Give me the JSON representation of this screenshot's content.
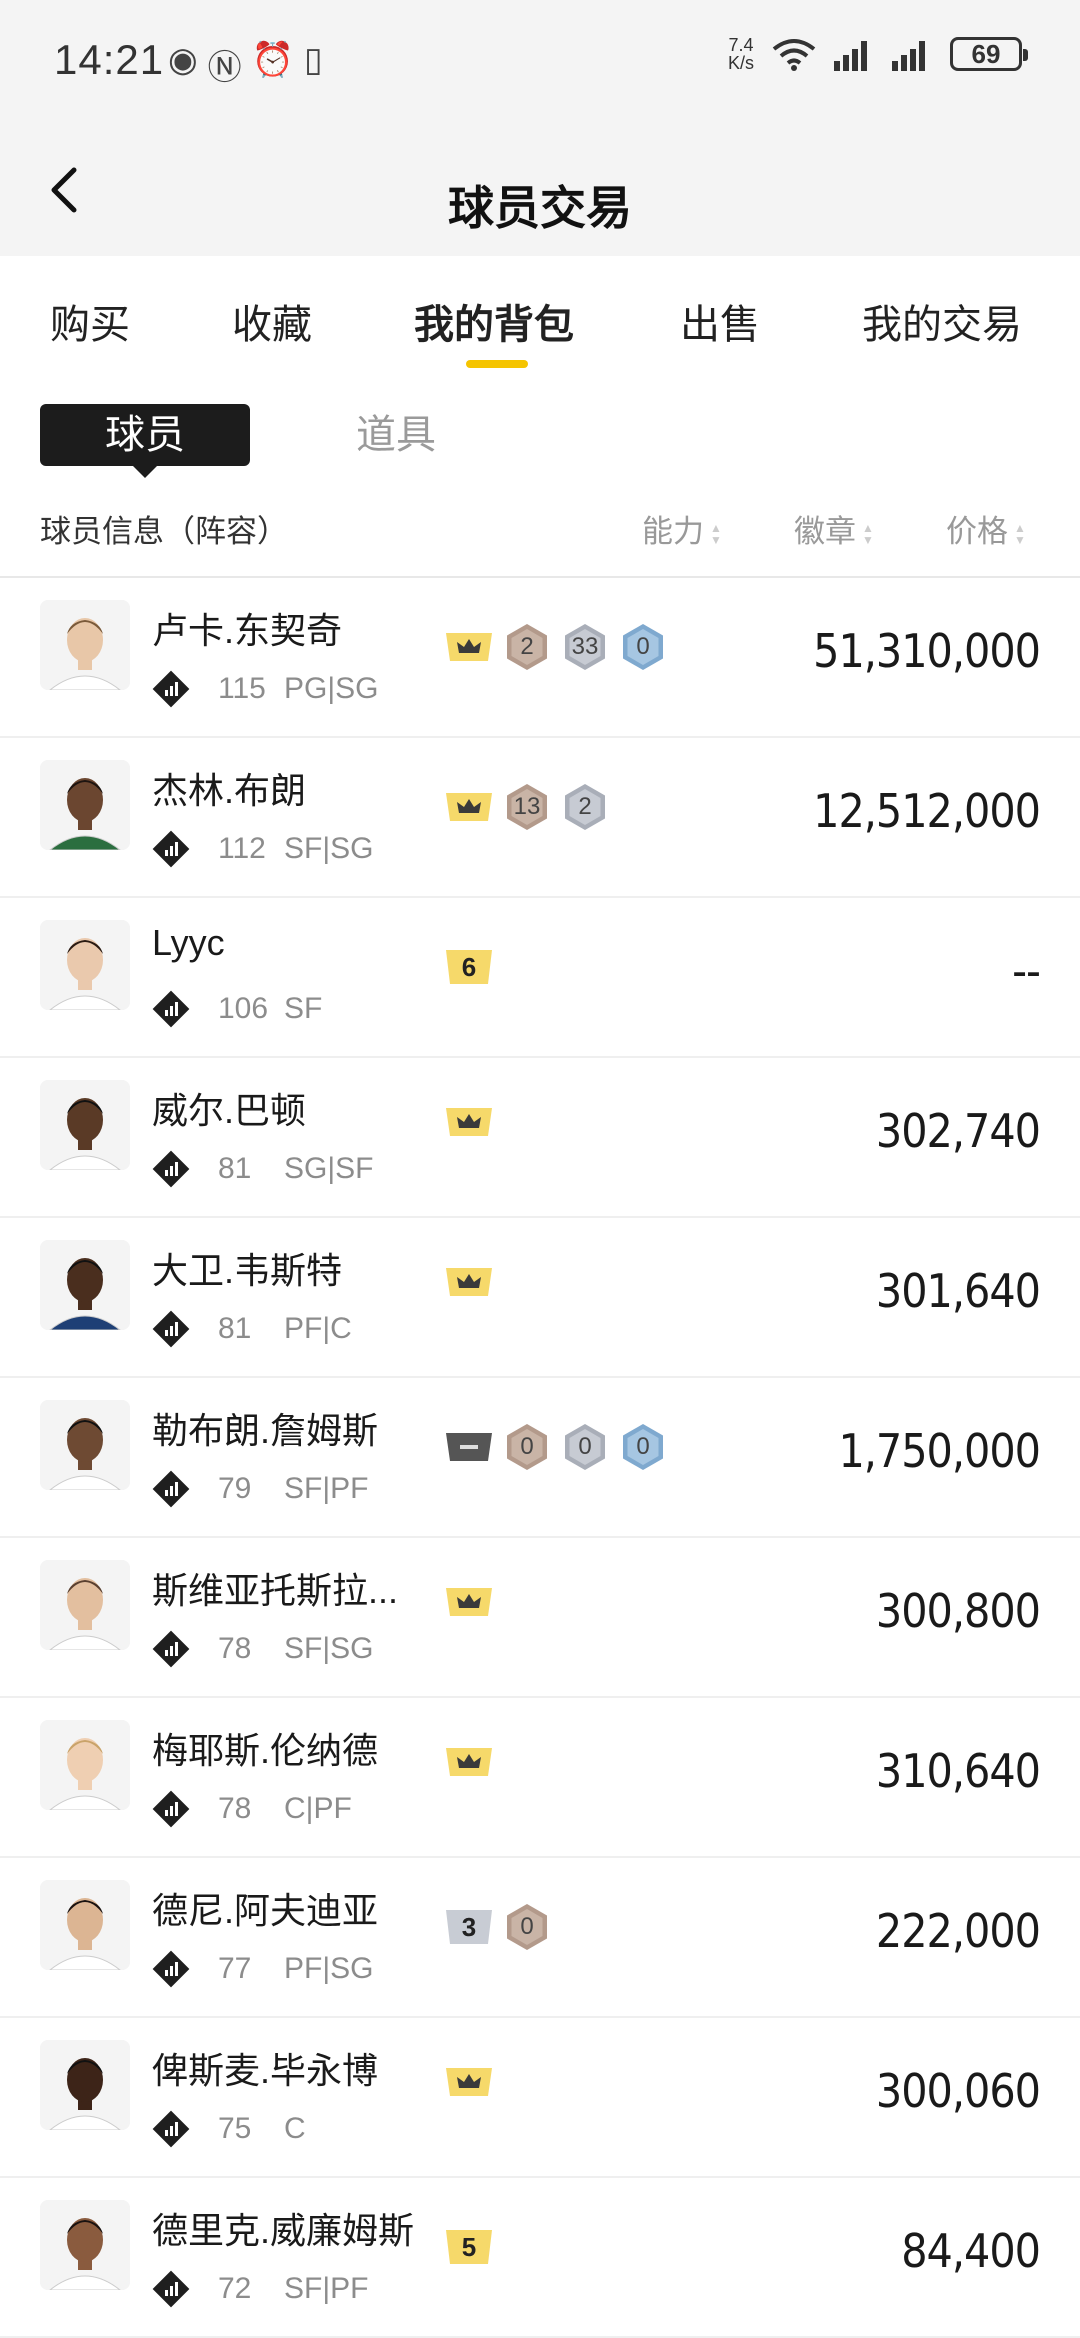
{
  "status_bar": {
    "time": "14:21",
    "net_speed_value": "7.4",
    "net_speed_unit": "K/s",
    "battery": "69"
  },
  "header": {
    "title": "球员交易"
  },
  "tabs": [
    {
      "label": "购买",
      "active": false
    },
    {
      "label": "收藏",
      "active": false
    },
    {
      "label": "我的背包",
      "active": true
    },
    {
      "label": "出售",
      "active": false
    },
    {
      "label": "我的交易",
      "active": false
    }
  ],
  "segments": {
    "players": "球员",
    "items": "道具"
  },
  "columns": {
    "info": "球员信息（阵容）",
    "ability": "能力",
    "badge": "徽章",
    "price": "价格"
  },
  "colors": {
    "accent": "#f5c400",
    "crown_bg": "#f6d96a",
    "badge_bronze": "#b39a8b",
    "badge_silver": "#a9aeb8",
    "badge_gold_blue": "#7fa9cf"
  },
  "players": [
    {
      "name": "卢卡.东契奇",
      "rating": "115",
      "positions": "PG|SG",
      "price": "51,310,000",
      "badges": [
        {
          "type": "crown"
        },
        {
          "type": "bronze",
          "value": "2"
        },
        {
          "type": "silver",
          "value": "33"
        },
        {
          "type": "blue",
          "value": "0"
        }
      ]
    },
    {
      "name": "杰林.布朗",
      "rating": "112",
      "positions": "SF|SG",
      "price": "12,512,000",
      "badges": [
        {
          "type": "crown"
        },
        {
          "type": "bronze",
          "value": "13"
        },
        {
          "type": "silver",
          "value": "2"
        }
      ]
    },
    {
      "name": "Lyyc",
      "rating": "106",
      "positions": "SF",
      "price": "--",
      "badges": [
        {
          "type": "yellow-num",
          "value": "6"
        }
      ]
    },
    {
      "name": "威尔.巴顿",
      "rating": "81",
      "positions": "SG|SF",
      "price": "302,740",
      "badges": [
        {
          "type": "crown"
        }
      ]
    },
    {
      "name": "大卫.韦斯特",
      "rating": "81",
      "positions": "PF|C",
      "price": "301,640",
      "badges": [
        {
          "type": "crown"
        }
      ]
    },
    {
      "name": "勒布朗.詹姆斯",
      "rating": "79",
      "positions": "SF|PF",
      "price": "1,750,000",
      "badges": [
        {
          "type": "dark-bar"
        },
        {
          "type": "bronze",
          "value": "0"
        },
        {
          "type": "silver",
          "value": "0"
        },
        {
          "type": "blue",
          "value": "0"
        }
      ]
    },
    {
      "name": "斯维亚托斯拉...",
      "rating": "78",
      "positions": "SF|SG",
      "price": "300,800",
      "badges": [
        {
          "type": "crown"
        }
      ]
    },
    {
      "name": "梅耶斯.伦纳德",
      "rating": "78",
      "positions": "C|PF",
      "price": "310,640",
      "badges": [
        {
          "type": "crown"
        }
      ]
    },
    {
      "name": "德尼.阿夫迪亚",
      "rating": "77",
      "positions": "PF|SG",
      "price": "222,000",
      "badges": [
        {
          "type": "silver-num",
          "value": "3"
        },
        {
          "type": "bronze",
          "value": "0"
        }
      ]
    },
    {
      "name": "俾斯麦.毕永博",
      "rating": "75",
      "positions": "C",
      "price": "300,060",
      "badges": [
        {
          "type": "crown"
        }
      ]
    },
    {
      "name": "德里克.威廉姆斯",
      "rating": "72",
      "positions": "SF|PF",
      "price": "84,400",
      "badges": [
        {
          "type": "yellow-num",
          "value": "5"
        }
      ]
    }
  ]
}
